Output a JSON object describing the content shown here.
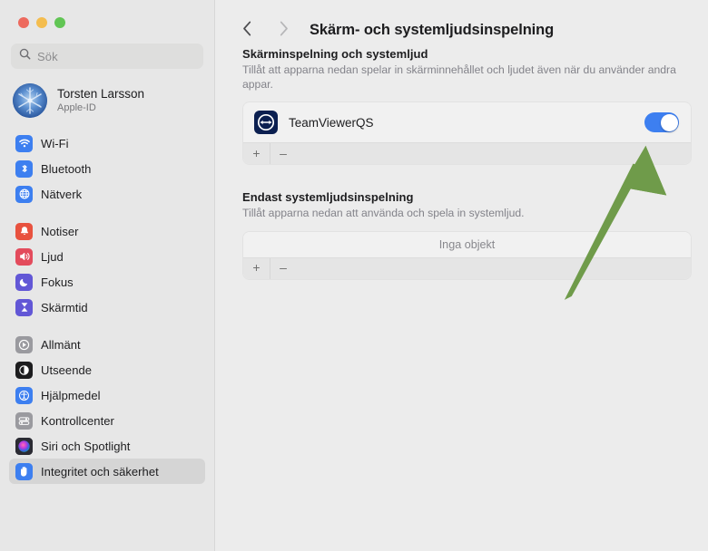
{
  "window": {
    "traffic_lights": [
      {
        "name": "close",
        "color": "#ed6a5e"
      },
      {
        "name": "minimize",
        "color": "#f4bd4f"
      },
      {
        "name": "zoom",
        "color": "#61c554"
      }
    ]
  },
  "sidebar": {
    "search": {
      "placeholder": "Sök",
      "value": "",
      "icon": "search-icon"
    },
    "account": {
      "name": "Torsten Larsson",
      "subtitle": "Apple-ID",
      "avatar": "user-avatar"
    },
    "groups": [
      {
        "items": [
          {
            "label": "Wi-Fi",
            "icon": "wifi-icon",
            "color": "#3d7ff0",
            "selected": false
          },
          {
            "label": "Bluetooth",
            "icon": "bluetooth-icon",
            "color": "#3d7ff0",
            "selected": false
          },
          {
            "label": "Nätverk",
            "icon": "network-globe-icon",
            "color": "#3d7ff0",
            "selected": false
          }
        ]
      },
      {
        "items": [
          {
            "label": "Notiser",
            "icon": "bell-icon",
            "color": "#e8523f",
            "selected": false
          },
          {
            "label": "Ljud",
            "icon": "speaker-icon",
            "color": "#e34b5c",
            "selected": false
          },
          {
            "label": "Fokus",
            "icon": "moon-icon",
            "color": "#6257d6",
            "selected": false
          },
          {
            "label": "Skärmtid",
            "icon": "hourglass-icon",
            "color": "#6257d6",
            "selected": false
          }
        ]
      },
      {
        "items": [
          {
            "label": "Allmänt",
            "icon": "gear-icon",
            "color": "#8e8e93",
            "selected": false
          },
          {
            "label": "Utseende",
            "icon": "appearance-icon",
            "color": "#1c1c1e",
            "selected": false
          },
          {
            "label": "Hjälpmedel",
            "icon": "accessibility-icon",
            "color": "#3d7ff0",
            "selected": false
          },
          {
            "label": "Kontrollcenter",
            "icon": "control-center-icon",
            "color": "#8e8e93",
            "selected": false
          },
          {
            "label": "Siri och Spotlight",
            "icon": "siri-icon",
            "color": "#2b2b33",
            "selected": false
          },
          {
            "label": "Integritet och säkerhet",
            "icon": "privacy-hand-icon",
            "color": "#3d7ff0",
            "selected": true
          }
        ]
      }
    ]
  },
  "toolbar": {
    "back_icon": "chevron-left-icon",
    "forward_icon": "chevron-right-icon",
    "title": "Skärm- och systemljudsinspelning"
  },
  "main": {
    "sections": [
      {
        "title": "Skärminspelning och systemljud",
        "description": "Tillåt att apparna nedan spelar in skärminnehållet och ljudet även när du använder andra appar.",
        "empty_text": "",
        "apps": [
          {
            "name": "TeamViewerQS",
            "icon": "teamviewer-icon",
            "enabled": true
          }
        ],
        "footer": {
          "add_label": "+",
          "remove_label": "–"
        }
      },
      {
        "title": "Endast systemljudsinspelning",
        "description": "Tillåt apparna nedan att använda och spela in systemljud.",
        "empty_text": "Inga objekt",
        "apps": [],
        "footer": {
          "add_label": "+",
          "remove_label": "–"
        }
      }
    ]
  },
  "annotation": {
    "type": "arrow",
    "color": "#6f9b4a",
    "points_to": "teamviewer-toggle"
  }
}
